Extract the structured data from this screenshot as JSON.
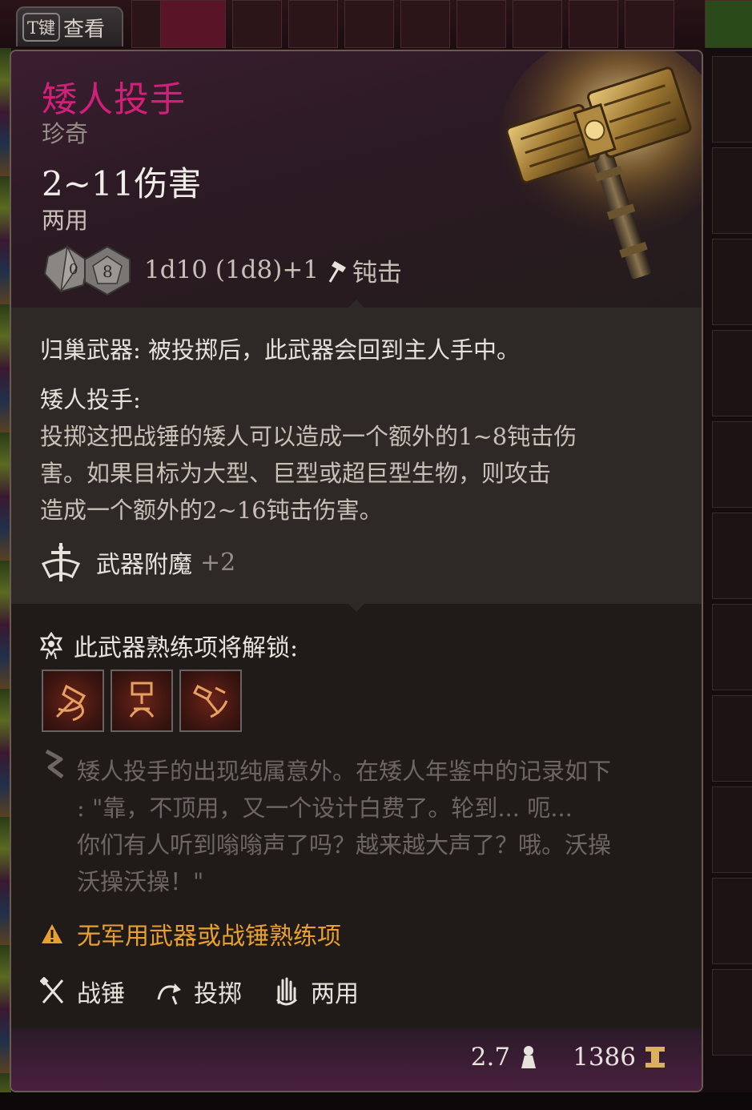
{
  "view_key": {
    "key": "T键",
    "label": "查看"
  },
  "item": {
    "name": "矮人投手",
    "rarity": "珍奇",
    "damage": "2~11伤害",
    "handedness": "两用",
    "dice": {
      "die_a": "0",
      "die_b": "8"
    },
    "dice_formula": "1d10 (1d8)+1",
    "damage_type": "钝击"
  },
  "properties": {
    "returning": "归巢武器: 被投掷后，此武器会回到主人手中。",
    "ability_title": "矮人投手:",
    "ability_lines": [
      "投掷这把战锤的矮人可以造成一个额外的1~8钝击伤",
      "害。如果目标为大型、巨型或超巨型生物，则攻击",
      "造成一个额外的2~16钝击伤害。"
    ],
    "enchant_label": "武器附魔",
    "enchant_value": "+2"
  },
  "unlock": {
    "title": "此武器熟练项将解锁:",
    "icons": [
      "weapon-action-icon-1",
      "weapon-action-icon-2",
      "weapon-action-icon-3"
    ]
  },
  "lore": [
    "矮人投手的出现纯属意外。在矮人年鉴中的记录如下",
    ": \"靠，不顶用，又一个设计白费了。轮到... 呃...",
    "你们有人听到嗡嗡声了吗？越来越大声了？哦。沃操",
    "沃操沃操！\""
  ],
  "warning": "无军用武器或战锤熟练项",
  "tags": [
    {
      "icon": "warhammer-icon",
      "label": "战锤"
    },
    {
      "icon": "throw-icon",
      "label": "投掷"
    },
    {
      "icon": "two-hand-icon",
      "label": "两用"
    }
  ],
  "footer": {
    "weight": "2.7",
    "value": "1386"
  },
  "colors": {
    "name": "#d0207a",
    "warning": "#e8a030",
    "gold": "#d8b060"
  }
}
